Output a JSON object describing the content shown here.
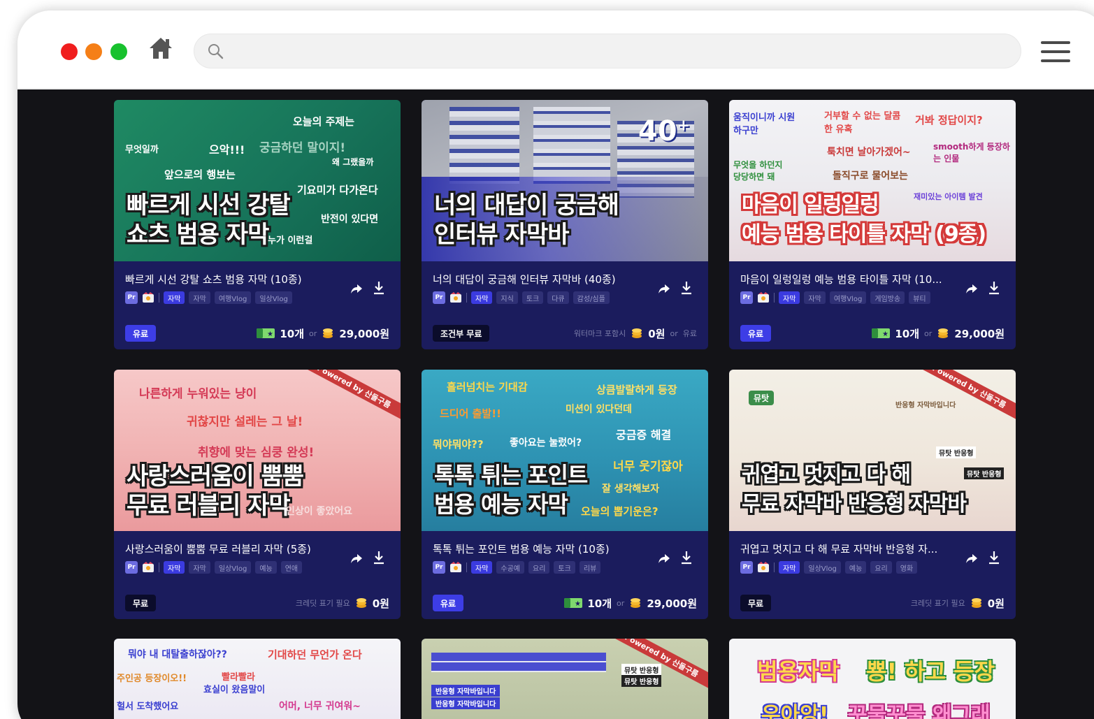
{
  "browser": {
    "search_placeholder": ""
  },
  "cards": [
    {
      "thumb": {
        "headline": "빠르게 시선 강탈\n쇼츠 범용 자막",
        "tags": [
          "오늘의 주제는",
          "무엇일까",
          "으악!!!",
          "궁금하던 말이지!",
          "왜 그랬을까",
          "앞으로의 행보는",
          "기요미가 다가온다",
          "반전이 있다면",
          "누가 이런걸"
        ]
      },
      "title": "빠르게 시선 강탈 쇼츠 범용 자막 (10종)",
      "tags": [
        "자막",
        "자막",
        "여행Vlog",
        "일상Vlog"
      ],
      "badge": "유료",
      "badge_type": "paid",
      "ticket": "10개",
      "or": "or",
      "price": "29,000원"
    },
    {
      "thumb": {
        "headline": "너의 대답이 궁금해\n인터뷰 자막바",
        "count": "40",
        "plus": "+"
      },
      "title": "너의 대답이 궁금해 인터뷰 자막바 (40종)",
      "tags": [
        "자막",
        "지식",
        "토크",
        "다큐",
        "감성/심플"
      ],
      "badge": "조건부 무료",
      "badge_type": "free",
      "note": "워터마크 포함시",
      "price": "0원",
      "or": "or",
      "alt": "유료"
    },
    {
      "thumb": {
        "headline": "마음이 일렁일렁\n예능 범용 타이틀 자막 (9종)",
        "tags": [
          "움직이니까 시원하구만",
          "거부할 수 없는 달콤한 유혹",
          "거봐 정답이지?",
          "툭치면 날아가겠어~",
          "smooth하게 등장하는 인물",
          "무엇을 하던지 당당하면 돼",
          "돌직구로 물어보는",
          "재미있는 아이템 발견"
        ]
      },
      "title": "마음이 일렁일렁 예능 범용 타이틀 자막 (10...",
      "tags": [
        "자막",
        "자막",
        "여행Vlog",
        "게임방송",
        "뷰티"
      ],
      "badge": "유료",
      "badge_type": "paid",
      "ticket": "10개",
      "or": "or",
      "price": "29,000원"
    },
    {
      "thumb": {
        "headline": "사랑스러움이 뿜뿜\n무료 러블리 자막",
        "powered": "Powered by 산돌구름",
        "tags": [
          "나른하게 누워있는 냥이",
          "귀찮지만 설레는 그 날!",
          "취향에 맞는 심쿵 완성!",
          "인상이 좋았어요"
        ]
      },
      "title": "사랑스러움이 뿜뿜 무료 러블리 자막 (5종)",
      "tags": [
        "자막",
        "자막",
        "일상Vlog",
        "예능",
        "연애"
      ],
      "badge": "무료",
      "badge_type": "free",
      "note": "크레딧 표기 필요",
      "price": "0원"
    },
    {
      "thumb": {
        "headline": "톡톡 튀는 포인트\n범용 예능 자막",
        "tags": [
          "흘러넘치는 기대감",
          "상큼발랄하게 등장",
          "드디어 출발!!",
          "미션이 있다던데",
          "궁금증 해결",
          "뭐야뭐야??",
          "좋아요는 눌렀어?",
          "너무 웃기잖아",
          "잘 생각해보자",
          "오늘의 뽑기운은?"
        ]
      },
      "title": "톡톡 튀는 포인트 범용 예능 자막 (10종)",
      "tags": [
        "자막",
        "수공예",
        "요리",
        "토크",
        "리뷰"
      ],
      "badge": "유료",
      "badge_type": "paid",
      "ticket": "10개",
      "or": "or",
      "price": "29,000원"
    },
    {
      "thumb": {
        "headline": "귀엽고 멋지고 다 해\n무료 자막바 반응형 자막바",
        "powered": "Powered by 산돌구름",
        "tags": [
          "뮤탓",
          "반응형 자막바입니다",
          "뮤탓 반응형",
          "뮤탓 반응형"
        ]
      },
      "title": "귀엽고 멋지고 다 해 무료 자막바 반응형 자...",
      "tags": [
        "자막",
        "일상Vlog",
        "예능",
        "요리",
        "영화"
      ],
      "badge": "무료",
      "badge_type": "free",
      "note": "크레딧 표기 필요",
      "price": "0원"
    },
    {
      "thumb": {
        "tags": [
          "뭐야 내 대탈출하잖아??",
          "기대하던 무언가 온다",
          "주인공 등장이오!!",
          "빨라빨라",
          "효실이 왔음말이",
          "헐서 도착했어요",
          "어머, 너무 귀여워~"
        ]
      }
    },
    {
      "thumb": {
        "powered": "Powered by 산돌구름",
        "tags": [
          "반응형 자막바입니다",
          "반응형 자막바입니다",
          "뮤탓 반응형",
          "뮤탓 반응형"
        ]
      }
    },
    {
      "thumb": {
        "tags": [
          "범용자막",
          "뿅! 하고 등장",
          "우아앙!",
          "꾸물꾸물 왜그래"
        ]
      }
    }
  ],
  "colors": {
    "content_bg": "#131317",
    "card_bg": "#1b1c5d",
    "accent": "#3d3de6"
  }
}
